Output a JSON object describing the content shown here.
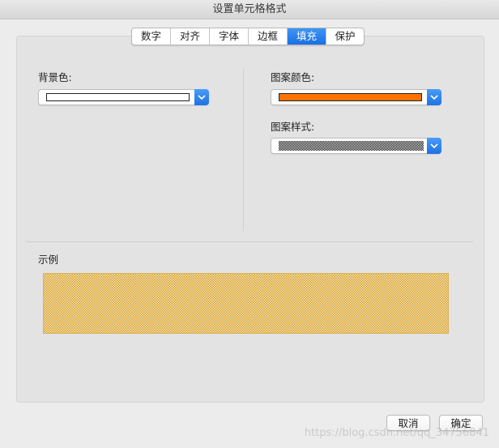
{
  "window": {
    "title": "设置单元格格式"
  },
  "tabs": [
    {
      "label": "数字",
      "active": false
    },
    {
      "label": "对齐",
      "active": false
    },
    {
      "label": "字体",
      "active": false
    },
    {
      "label": "边框",
      "active": false
    },
    {
      "label": "填充",
      "active": true
    },
    {
      "label": "保护",
      "active": false
    }
  ],
  "fill": {
    "background_color_label": "背景色:",
    "background_color_value": "#ffffff",
    "pattern_color_label": "图案颜色:",
    "pattern_color_value": "#ff7200",
    "pattern_style_label": "图案样式:"
  },
  "sample": {
    "label": "示例",
    "pattern_color": "#e8a000"
  },
  "buttons": {
    "cancel": "取消",
    "ok": "确定"
  },
  "watermark": "https://blog.csdn.net/qq_34756841",
  "colors": {
    "accent": "#1a6fe2"
  }
}
